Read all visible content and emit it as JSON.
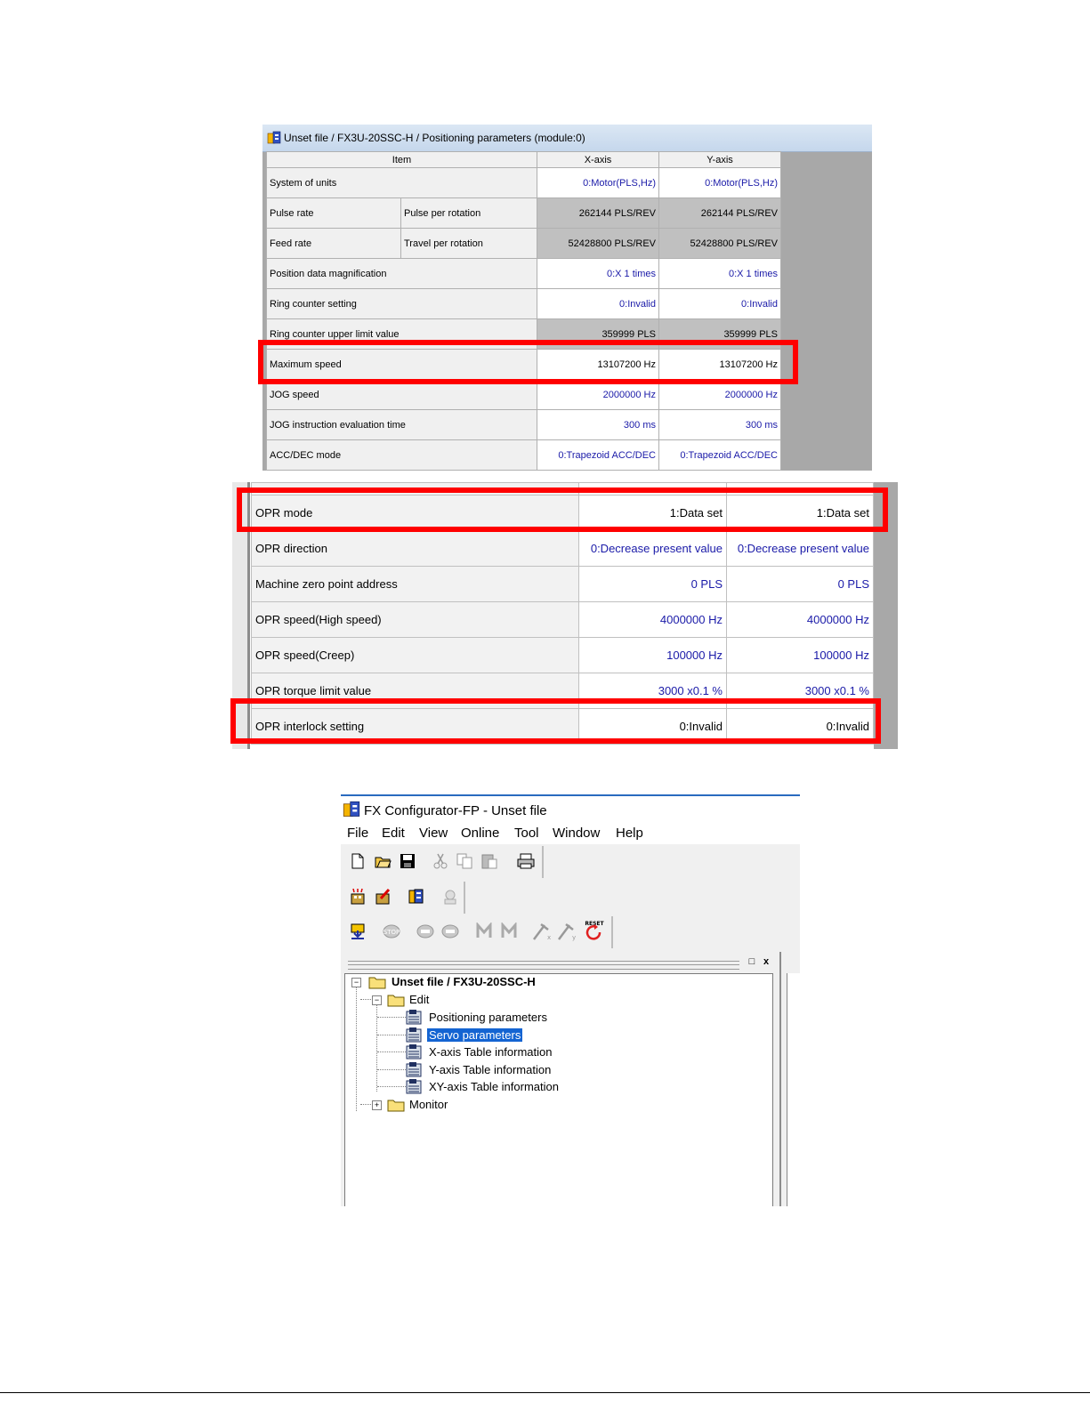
{
  "positioning": {
    "window_title": "Unset file / FX3U-20SSC-H / Positioning parameters (module:0)",
    "headers": {
      "item": "Item",
      "x_axis": "X-axis",
      "y_axis": "Y-axis"
    },
    "rows": [
      {
        "item": "System of units",
        "sub": "",
        "x": "0:Motor(PLS,Hz)",
        "y": "0:Motor(PLS,Hz)"
      },
      {
        "item": "Pulse rate",
        "sub": "Pulse per rotation",
        "x": "262144 PLS/REV",
        "y": "262144 PLS/REV"
      },
      {
        "item": "Feed rate",
        "sub": "Travel per rotation",
        "x": "52428800 PLS/REV",
        "y": "52428800 PLS/REV"
      },
      {
        "item": "Position data magnification",
        "sub": "",
        "x": "0:X 1 times",
        "y": "0:X 1 times"
      },
      {
        "item": "Ring counter setting",
        "sub": "",
        "x": "0:Invalid",
        "y": "0:Invalid"
      },
      {
        "item": "Ring counter upper limit value",
        "sub": "",
        "x": "359999 PLS",
        "y": "359999 PLS"
      },
      {
        "item": "Maximum speed",
        "sub": "",
        "x": "13107200 Hz",
        "y": "13107200 Hz"
      },
      {
        "item": "JOG speed",
        "sub": "",
        "x": "2000000 Hz",
        "y": "2000000 Hz"
      },
      {
        "item": "JOG instruction evaluation time",
        "sub": "",
        "x": "300 ms",
        "y": "300 ms"
      },
      {
        "item": "ACC/DEC mode",
        "sub": "",
        "x": "0:Trapezoid ACC/DEC",
        "y": "0:Trapezoid ACC/DEC"
      }
    ]
  },
  "opr": {
    "rows": [
      {
        "item": "OPR mode",
        "x": "1:Data set",
        "y": "1:Data set"
      },
      {
        "item": "OPR direction",
        "x": "0:Decrease present value",
        "y": "0:Decrease present value"
      },
      {
        "item": "Machine zero point address",
        "x": "0 PLS",
        "y": "0 PLS"
      },
      {
        "item": "OPR speed(High speed)",
        "x": "4000000 Hz",
        "y": "4000000 Hz"
      },
      {
        "item": "OPR speed(Creep)",
        "x": "100000 Hz",
        "y": "100000 Hz"
      },
      {
        "item": "OPR torque limit value",
        "x": "3000 x0.1 %",
        "y": "3000 x0.1 %"
      },
      {
        "item": "OPR interlock setting",
        "x": "0:Invalid",
        "y": "0:Invalid"
      }
    ]
  },
  "configurator": {
    "window_title": "FX Configurator-FP - Unset file",
    "menu": [
      "File",
      "Edit",
      "View",
      "Online",
      "Tool",
      "Window",
      "Help"
    ],
    "panel_buttons": {
      "restore": "□",
      "close": "x"
    },
    "tree": {
      "root": "Unset file / FX3U-20SSC-H",
      "edit": "Edit",
      "edit_items": [
        "Positioning parameters",
        "Servo parameters",
        "X-axis Table information",
        "Y-axis Table information",
        "XY-axis Table information"
      ],
      "selected": "Servo parameters",
      "monitor": "Monitor"
    },
    "toolbar_icons": [
      [
        "new-file-icon",
        "open-folder-icon",
        "save-icon",
        "cut-icon",
        "copy-icon",
        "paste-icon",
        "print-icon"
      ],
      [
        "new-module-icon",
        "delete-module-icon",
        "module-config-icon",
        "module-settings-icon"
      ],
      [
        "download-icon",
        "stop-icon",
        "servo-on-icon",
        "servo-off-icon",
        "monitor-m-icon",
        "monitor-m2-icon",
        "test-x-icon",
        "test-y-icon",
        "reset-icon"
      ]
    ],
    "reset_label": "RESET"
  },
  "colors": {
    "highlight": "#ff0000",
    "value_blue": "#1a1aa8",
    "selection": "#1464d2"
  }
}
